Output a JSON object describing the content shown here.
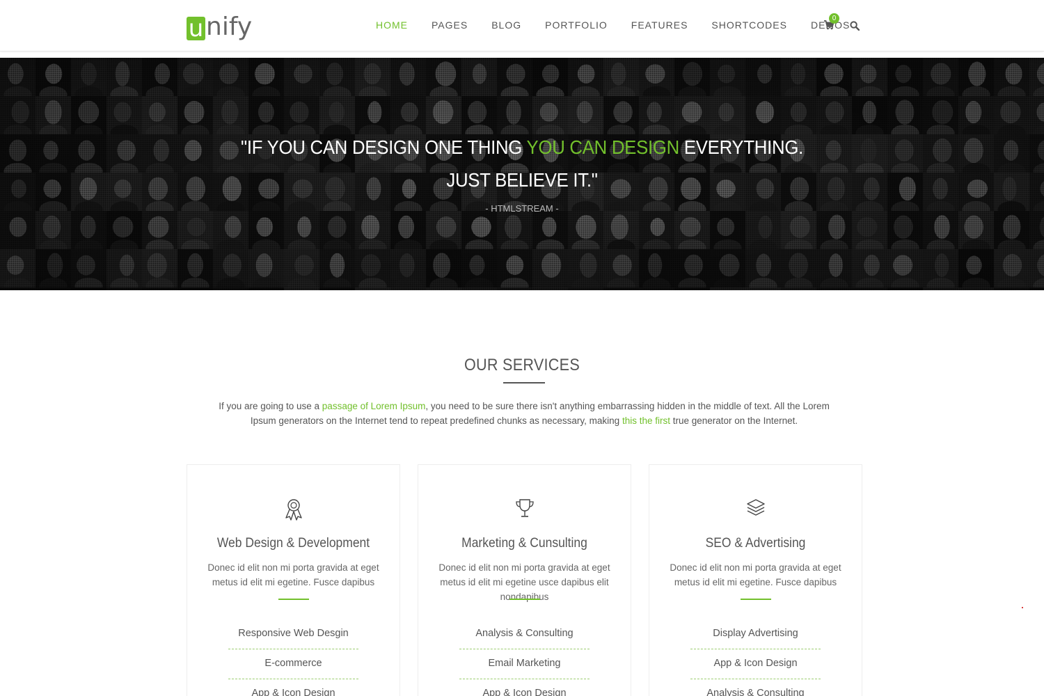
{
  "logo": {
    "first_letter": "u",
    "rest": "nify"
  },
  "nav": {
    "items": [
      {
        "label": "HOME",
        "active": true
      },
      {
        "label": "PAGES",
        "active": false
      },
      {
        "label": "BLOG",
        "active": false
      },
      {
        "label": "PORTFOLIO",
        "active": false
      },
      {
        "label": "FEATURES",
        "active": false
      },
      {
        "label": "SHORTCODES",
        "active": false
      },
      {
        "label": "DEMOS",
        "active": false
      }
    ],
    "cart_count": "0",
    "cart_icon": "shopping-cart-icon",
    "search_icon": "search-icon"
  },
  "hero": {
    "line1_pre": "\"IF YOU CAN DESIGN ONE THING ",
    "line1_highlight": "YOU CAN DESIGN",
    "line1_post": " EVERYTHING.",
    "line2": "JUST BELIEVE IT.\"",
    "author": "- HTMLSTREAM -"
  },
  "services": {
    "title": "OUR SERVICES",
    "desc_part1": "If you are going to use a ",
    "desc_link1": "passage of Lorem Ipsum",
    "desc_part2": ", you need to be sure there isn't anything embarrassing hidden in the middle of text. All the Lorem Ipsum generators on the Internet tend to repeat predefined chunks as necessary, making ",
    "desc_link2": "this the first",
    "desc_part3": " true generator on the Internet.",
    "cards": [
      {
        "icon": "badge-icon",
        "title": "Web Design & Development",
        "text": "Donec id elit non mi porta gravida at eget metus id elit mi egetine. Fusce dapibus",
        "items": [
          "Responsive Web Desgin",
          "E-commerce",
          "App & Icon Design"
        ]
      },
      {
        "icon": "trophy-icon",
        "title": "Marketing & Cunsulting",
        "text": "Donec id elit non mi porta gravida at eget metus id elit mi egetine usce dapibus elit nondapibus",
        "items": [
          "Analysis & Consulting",
          "Email Marketing",
          "App & Icon Design"
        ]
      },
      {
        "icon": "layers-icon",
        "title": "SEO & Advertising",
        "text": "Donec id elit non mi porta gravida at eget metus id elit mi egetine. Fusce dapibus",
        "items": [
          "Display Advertising",
          "App & Icon Design",
          "Analysis & Consulting"
        ]
      }
    ]
  },
  "colors": {
    "accent": "#72c02c",
    "text": "#555555",
    "hero_bg": "#1b1b1b"
  }
}
